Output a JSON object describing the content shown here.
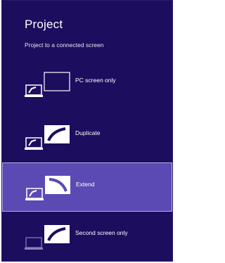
{
  "panel": {
    "title": "Project",
    "subtitle": "Project to a connected screen"
  },
  "options": [
    {
      "label": "PC screen only",
      "icon": "pc-screen-only-icon",
      "selected": false
    },
    {
      "label": "Duplicate",
      "icon": "duplicate-icon",
      "selected": false
    },
    {
      "label": "Extend",
      "icon": "extend-icon",
      "selected": true
    },
    {
      "label": "Second screen only",
      "icon": "second-screen-only-icon",
      "selected": false
    }
  ],
  "colors": {
    "panel_bg": "#1c0d5e",
    "selected_bg": "#5b4ab4",
    "selected_border": "#b7ade8",
    "text": "#ffffff"
  }
}
